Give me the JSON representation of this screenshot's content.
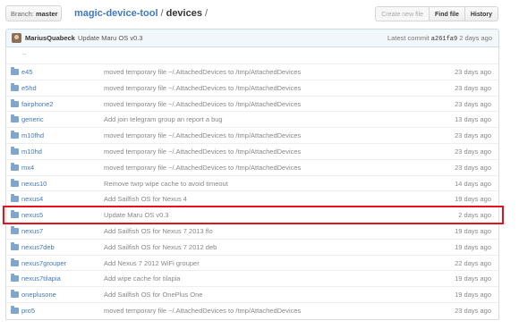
{
  "toolbar": {
    "branch_prefix": "Branch:",
    "branch_name": "master",
    "repo": "magic-device-tool",
    "separator": "/",
    "directory": "devices",
    "trailing": "/",
    "new_file_label": "Create new file",
    "find_file_label": "Find file",
    "history_label": "History"
  },
  "commit": {
    "author": "MariusQuabeck",
    "message": "Update Maru OS v0.3",
    "latest_label": "Latest commit",
    "sha": "a261fa9",
    "age": "2 days ago"
  },
  "parent_link": "..",
  "files": [
    {
      "name": "e45",
      "message": "moved temporary file ~/.AttachedDevices to /tmp/AttachedDevices",
      "age": "23 days ago"
    },
    {
      "name": "e5hd",
      "message": "moved temporary file ~/.AttachedDevices to /tmp/AttachedDevices",
      "age": "23 days ago"
    },
    {
      "name": "fairphone2",
      "message": "moved temporary file ~/.AttachedDevices to /tmp/AttachedDevices",
      "age": "23 days ago"
    },
    {
      "name": "generic",
      "message": "Add join telegram group an report a bug",
      "age": "13 days ago"
    },
    {
      "name": "m10fhd",
      "message": "moved temporary file ~/.AttachedDevices to /tmp/AttachedDevices",
      "age": "23 days ago"
    },
    {
      "name": "m10hd",
      "message": "moved temporary file ~/.AttachedDevices to /tmp/AttachedDevices",
      "age": "23 days ago"
    },
    {
      "name": "mx4",
      "message": "moved temporary file ~/.AttachedDevices to /tmp/AttachedDevices",
      "age": "23 days ago"
    },
    {
      "name": "nexus10",
      "message": "Remove twrp wipe cache to avoid timeout",
      "age": "14 days ago"
    },
    {
      "name": "nexus4",
      "message": "Add Sailfish OS for Nexus 4",
      "age": "19 days ago"
    },
    {
      "name": "nexus5",
      "message": "Update Maru OS v0.3",
      "age": "2 days ago"
    },
    {
      "name": "nexus7",
      "message": "Add Sailfish OS for Nexus 7 2013 flo",
      "age": "19 days ago"
    },
    {
      "name": "nexus7deb",
      "message": "Add Sailfish OS for Nexus 7 2012 deb",
      "age": "19 days ago"
    },
    {
      "name": "nexus7grouper",
      "message": "Add Nexus 7 2012 WiFi grouper",
      "age": "22 days ago"
    },
    {
      "name": "nexus7tilapia",
      "message": "Add wipe cache for tilapia",
      "age": "19 days ago"
    },
    {
      "name": "oneplusone",
      "message": "Add Sailfish OS for OnePlus One",
      "age": "19 days ago"
    },
    {
      "name": "pro5",
      "message": "moved temporary file ~/.AttachedDevices to /tmp/AttachedDevices",
      "age": "23 days ago"
    }
  ],
  "icons": {
    "folder": "folder-icon",
    "caret": "caret-down-icon",
    "avatar": "user-avatar"
  },
  "colors": {
    "link": "#4078c0",
    "folder": "#80a6cd",
    "highlight": "#e3121c",
    "commit_bg": "#f2f8fa"
  }
}
